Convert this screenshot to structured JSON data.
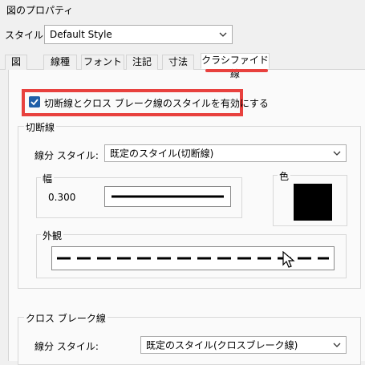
{
  "window": {
    "title": "図のプロパティ"
  },
  "style_selector": {
    "label": "スタイル:",
    "value": "Default Style"
  },
  "tabs": [
    {
      "label": "図",
      "active": false
    },
    {
      "label": "線種",
      "active": false
    },
    {
      "label": "フォント",
      "active": false
    },
    {
      "label": "注記",
      "active": false
    },
    {
      "label": "寸法",
      "active": false
    },
    {
      "label": "クラシファイド線",
      "active": true
    }
  ],
  "enable_checkbox": {
    "label": "切断線とクロス ブレーク線のスタイルを有効にする",
    "checked": true
  },
  "section_line": {
    "title": "切断線",
    "segment_style_label": "線分 スタイル:",
    "segment_style_value": "既定のスタイル(切断線)",
    "width_group_title": "幅",
    "width_value": "0.300",
    "color_group_title": "色",
    "color": "#000000",
    "appearance_group_title": "外観"
  },
  "section_crossbreak": {
    "title": "クロス ブレーク線",
    "segment_style_label": "線分 スタイル:",
    "segment_style_value": "既定のスタイル(クロスブレーク線)"
  },
  "colors": {
    "accent_red": "#e8413e",
    "checkbox_blue": "#1f5fa8"
  }
}
